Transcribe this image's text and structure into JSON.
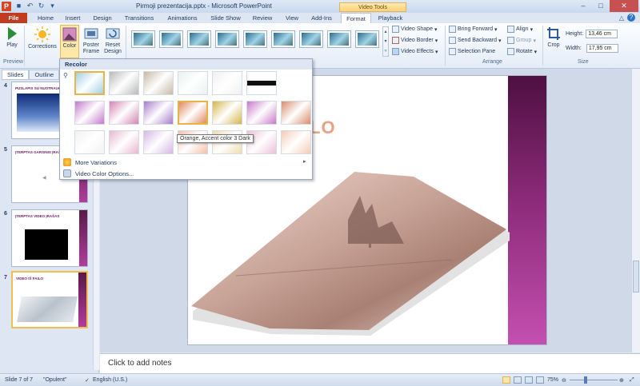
{
  "window": {
    "title": "Pirmoji prezentacija.pptx - Microsoft PowerPoint",
    "minimize": "–",
    "maximize": "□",
    "close": "✕"
  },
  "ribbon_tabs": {
    "contextual_label": "Video Tools",
    "items": [
      "File",
      "Home",
      "Insert",
      "Design",
      "Transitions",
      "Animations",
      "Slide Show",
      "Review",
      "View",
      "Add-Ins",
      "Format",
      "Playback"
    ],
    "active": "Format"
  },
  "ribbon": {
    "play": "Play",
    "preview_group": "Preview",
    "corrections": "Corrections",
    "color": "Color",
    "poster_frame": "Poster Frame",
    "reset_design": "Reset Design",
    "video_shape": "Video Shape",
    "video_border": "Video Border",
    "video_effects": "Video Effects",
    "bring_forward": "Bring Forward",
    "send_backward": "Send Backward",
    "selection_pane": "Selection Pane",
    "align": "Align",
    "group": "Group",
    "rotate": "Rotate",
    "arrange_group": "Arrange",
    "crop": "Crop",
    "height_label": "Height:",
    "height_value": "13,46 cm",
    "width_label": "Width:",
    "width_value": "17,95 cm",
    "size_group": "Size"
  },
  "left_panel": {
    "tabs": [
      "Slides",
      "Outline"
    ],
    "close": "×",
    "slides": [
      {
        "number": "4",
        "title": "PUSLAPIS SU NUOTRAUKA"
      },
      {
        "number": "5",
        "title": "ĮTERPTAS GARSINIS ĮRAŠAS"
      },
      {
        "number": "6",
        "title": "ĮTERPTAS VIDEO ĮRAŠAS"
      },
      {
        "number": "7",
        "title": "VIDEO IŠ FAILO"
      }
    ]
  },
  "slide": {
    "title_fragment": "LO"
  },
  "color_menu": {
    "header": "Recolor",
    "more_variations": "More Variations",
    "video_color_options": "Video Color Options...",
    "tooltip": "Orange, Accent color 3 Dark",
    "swatch_rows": [
      [
        "#9fd0e6",
        "#b9b9b9",
        "#c8b9a6",
        "#e6f2f0",
        "#f0f0f0",
        "#111111"
      ],
      [
        "#c27acb",
        "#d384b3",
        "#a77cc9",
        "#e08b62",
        "#d4b64a",
        "#c978c7",
        "#d98c6c"
      ],
      [
        "#f2f2f2",
        "#e7b8cf",
        "#d4b8e3",
        "#f2c0ad",
        "#efdbb0",
        "#eac0d8",
        "#f3cdb8"
      ]
    ],
    "accent_color": "#e8b445"
  },
  "notes": {
    "placeholder": "Click to add notes"
  },
  "status_bar": {
    "slide_info": "Slide 7 of 7",
    "theme": "\"Opulent\"",
    "language": "English (U.S.)",
    "zoom": "75%"
  }
}
